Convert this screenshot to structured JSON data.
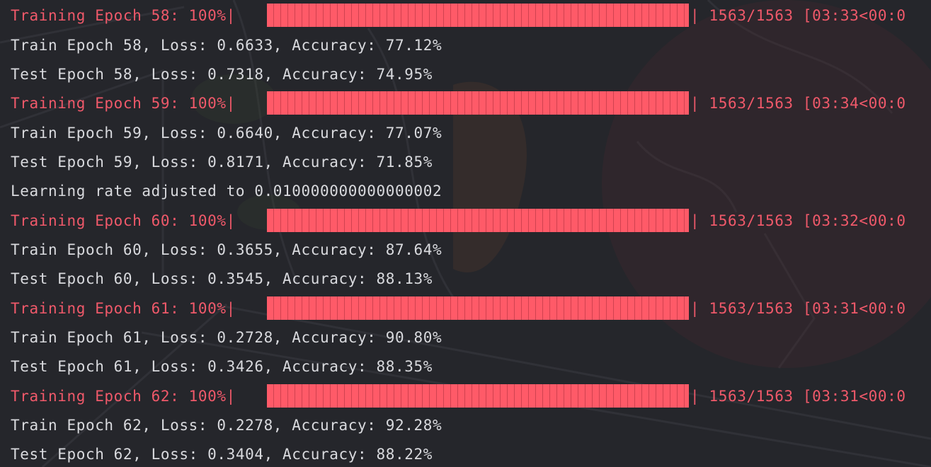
{
  "terminal": {
    "epochs": [
      {
        "progress_prefix": "Training Epoch 58: 100%|",
        "progress_fraction": 1.0,
        "progress_suffix": "| 1563/1563 [03:33<00:0",
        "train_line": "Train Epoch 58, Loss: 0.6633, Accuracy: 77.12%",
        "test_line": "Test Epoch 58, Loss: 0.7318, Accuracy: 74.95%"
      },
      {
        "progress_prefix": "Training Epoch 59: 100%|",
        "progress_fraction": 1.0,
        "progress_suffix": "| 1563/1563 [03:34<00:0",
        "train_line": "Train Epoch 59, Loss: 0.6640, Accuracy: 77.07%",
        "test_line": "Test Epoch 59, Loss: 0.8171, Accuracy: 71.85%",
        "note_line": "Learning rate adjusted to 0.010000000000000002"
      },
      {
        "progress_prefix": "Training Epoch 60: 100%|",
        "progress_fraction": 1.0,
        "progress_suffix": "| 1563/1563 [03:32<00:0",
        "train_line": "Train Epoch 60, Loss: 0.3655, Accuracy: 87.64%",
        "test_line": "Test Epoch 60, Loss: 0.3545, Accuracy: 88.13%"
      },
      {
        "progress_prefix": "Training Epoch 61: 100%|",
        "progress_fraction": 1.0,
        "progress_suffix": "| 1563/1563 [03:31<00:0",
        "train_line": "Train Epoch 61, Loss: 0.2728, Accuracy: 90.80%",
        "test_line": "Test Epoch 61, Loss: 0.3426, Accuracy: 88.35%"
      },
      {
        "progress_prefix": "Training Epoch 62: 100%|",
        "progress_fraction": 1.0,
        "progress_suffix": "| 1563/1563 [03:31<00:0",
        "train_line": "Train Epoch 62, Loss: 0.2278, Accuracy: 92.28%",
        "test_line": "Test Epoch 62, Loss: 0.3404, Accuracy: 88.22%"
      }
    ]
  },
  "colors": {
    "background": "#232428",
    "text": "#d9dade",
    "progress_text": "#f0596a",
    "progress_bar": "#ff5a68"
  }
}
